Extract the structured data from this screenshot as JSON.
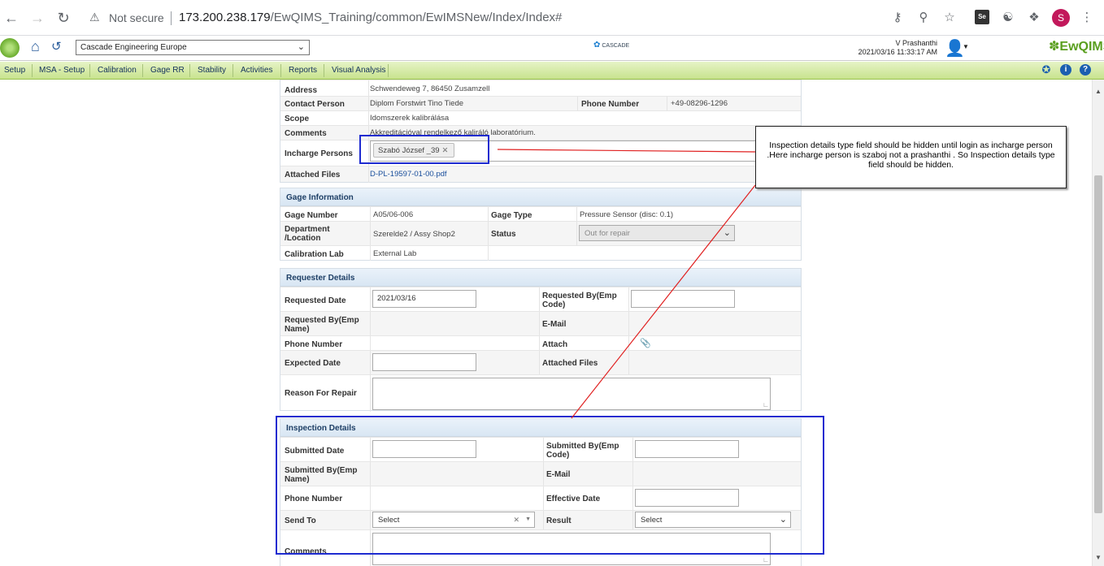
{
  "browser": {
    "not_secure": "Not secure",
    "url_host": "173.200.238.179",
    "url_path": "/EwQIMS_Training/common/EwIMSNew/Index/Index#",
    "profile_initial": "S"
  },
  "header": {
    "org": "Cascade Engineering Europe",
    "cascade_logo": "CASCADE",
    "user_name": "V Prashanthi",
    "user_datetime": "2021/03/16 11:33:17 AM",
    "brand": "EwQIMS"
  },
  "menu": {
    "items": [
      "Setup",
      "MSA - Setup",
      "Calibration",
      "Gage RR",
      "Stability",
      "Activities",
      "Reports",
      "Visual Analysis"
    ]
  },
  "lab_info": {
    "address_label": "Address",
    "address_value": "Schwendeweg 7, 86450 Zusamzell",
    "contact_label": "Contact Person",
    "contact_value": "Diplom Forstwirt Tino Tiede",
    "phone_label": "Phone Number",
    "phone_value": "+49-08296-1296",
    "scope_label": "Scope",
    "scope_value": "Idomszerek kalibrálása",
    "comments_label": "Comments",
    "comments_value": "Akkreditációval rendelkező kaliráló laboratórium.",
    "incharge_label": "Incharge Persons",
    "incharge_chip": "Szabó József _39",
    "files_label": "Attached Files",
    "files_value": "D-PL-19597-01-00.pdf"
  },
  "gage": {
    "title": "Gage Information",
    "number_label": "Gage Number",
    "number_value": "A05/06-006",
    "type_label": "Gage Type",
    "type_value": "Pressure Sensor (disc: 0.1)",
    "dept_label": "Department /Location",
    "dept_value": "Szerelde2 / Assy Shop2",
    "status_label": "Status",
    "status_value": "Out for repair",
    "lab_label": "Calibration Lab",
    "lab_value": "External Lab"
  },
  "requester": {
    "title": "Requester Details",
    "req_date_label": "Requested Date",
    "req_date_value": "2021/03/16",
    "req_by_code_label": "Requested By(Emp Code)",
    "req_by_name_label": "Requested By(Emp Name)",
    "email_label": "E-Mail",
    "phone_label": "Phone Number",
    "attach_label": "Attach",
    "expected_label": "Expected Date",
    "attached_files_label": "Attached Files",
    "reason_label": "Reason For Repair"
  },
  "inspection": {
    "title": "Inspection Details",
    "submitted_date_label": "Submitted Date",
    "submitted_by_code_label": "Submitted By(Emp Code)",
    "submitted_by_name_label": "Submitted By(Emp Name)",
    "email_label": "E-Mail",
    "phone_label": "Phone Number",
    "effective_label": "Effective Date",
    "send_to_label": "Send To",
    "send_to_value": "Select",
    "result_label": "Result",
    "result_value": "Select",
    "comments_label": "Comments"
  },
  "annotation": {
    "text": "Inspection details type field should be hidden until login as incharge person .Here incharge person is szaboj not a prashanthi . So Inspection details type field should be hidden."
  },
  "colors": {
    "menu_bar": "#c8e38e",
    "panel_header": "#d8e6f3",
    "annotation_blue": "#1e2bd0",
    "annotation_red": "#e02020"
  }
}
